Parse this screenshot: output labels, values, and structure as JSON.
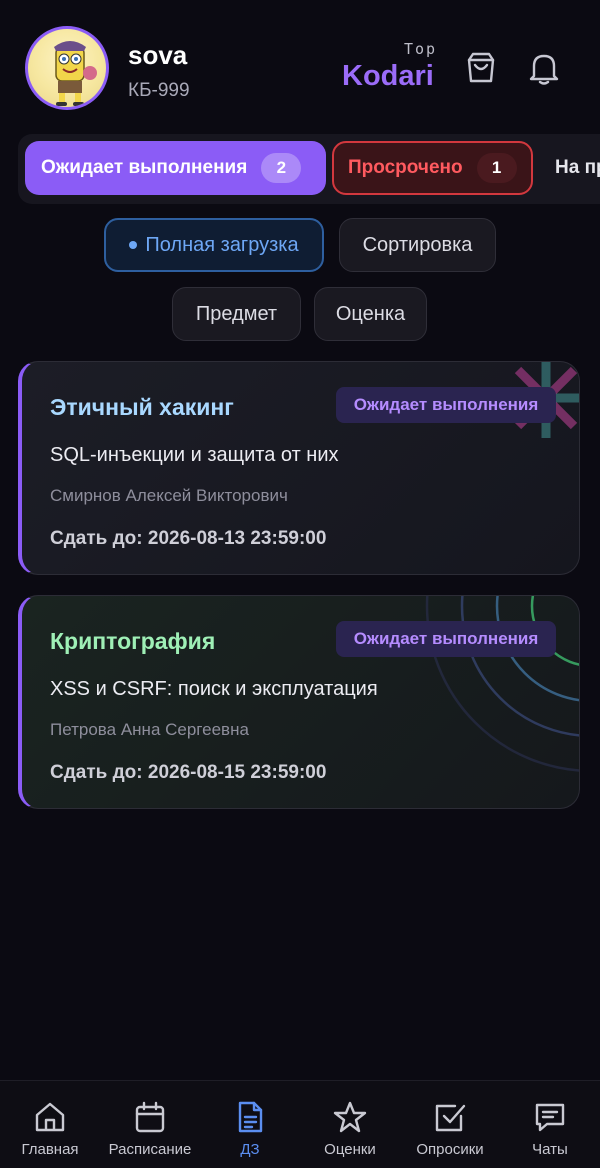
{
  "profile": {
    "username": "sova",
    "group": "КБ-999"
  },
  "header": {
    "top_label": "Top",
    "brand": "Kodari",
    "icons": [
      "shopping-bag-icon",
      "bell-icon"
    ]
  },
  "tabs": [
    {
      "label": "Ожидает выполнения",
      "count": "2",
      "active": true
    },
    {
      "label": "Просрочено",
      "count": "1",
      "active": false
    },
    {
      "label": "На пр"
    }
  ],
  "filters": {
    "load": "Полная загрузка",
    "sort": "Сортировка",
    "subject": "Предмет",
    "grade": "Оценка"
  },
  "assignments": [
    {
      "subject": "Этичный хакинг",
      "status": "Ожидает выполнения",
      "topic": "SQL-инъекции и защита от них",
      "teacher": "Смирнов Алексей Викторович",
      "deadline": "Сдать до: 2026-08-13 23:59:00"
    },
    {
      "subject": "Криптография",
      "status": "Ожидает выполнения",
      "topic": "XSS и CSRF: поиск и эксплуатация",
      "teacher": "Петрова Анна Сергеевна",
      "deadline": "Сдать до: 2026-08-15 23:59:00"
    }
  ],
  "nav": [
    {
      "label": "Главная",
      "icon": "home-icon"
    },
    {
      "label": "Расписание",
      "icon": "calendar-icon"
    },
    {
      "label": "ДЗ",
      "icon": "document-icon",
      "active": true
    },
    {
      "label": "Оценки",
      "icon": "star-icon"
    },
    {
      "label": "Опросики",
      "icon": "checkbox-icon"
    },
    {
      "label": "Чаты",
      "icon": "chat-icon"
    }
  ],
  "colors": {
    "accent": "#8b5cf6",
    "overdue": "#d2383e",
    "active_nav": "#5b8ef0",
    "background": "#0b0a12"
  }
}
